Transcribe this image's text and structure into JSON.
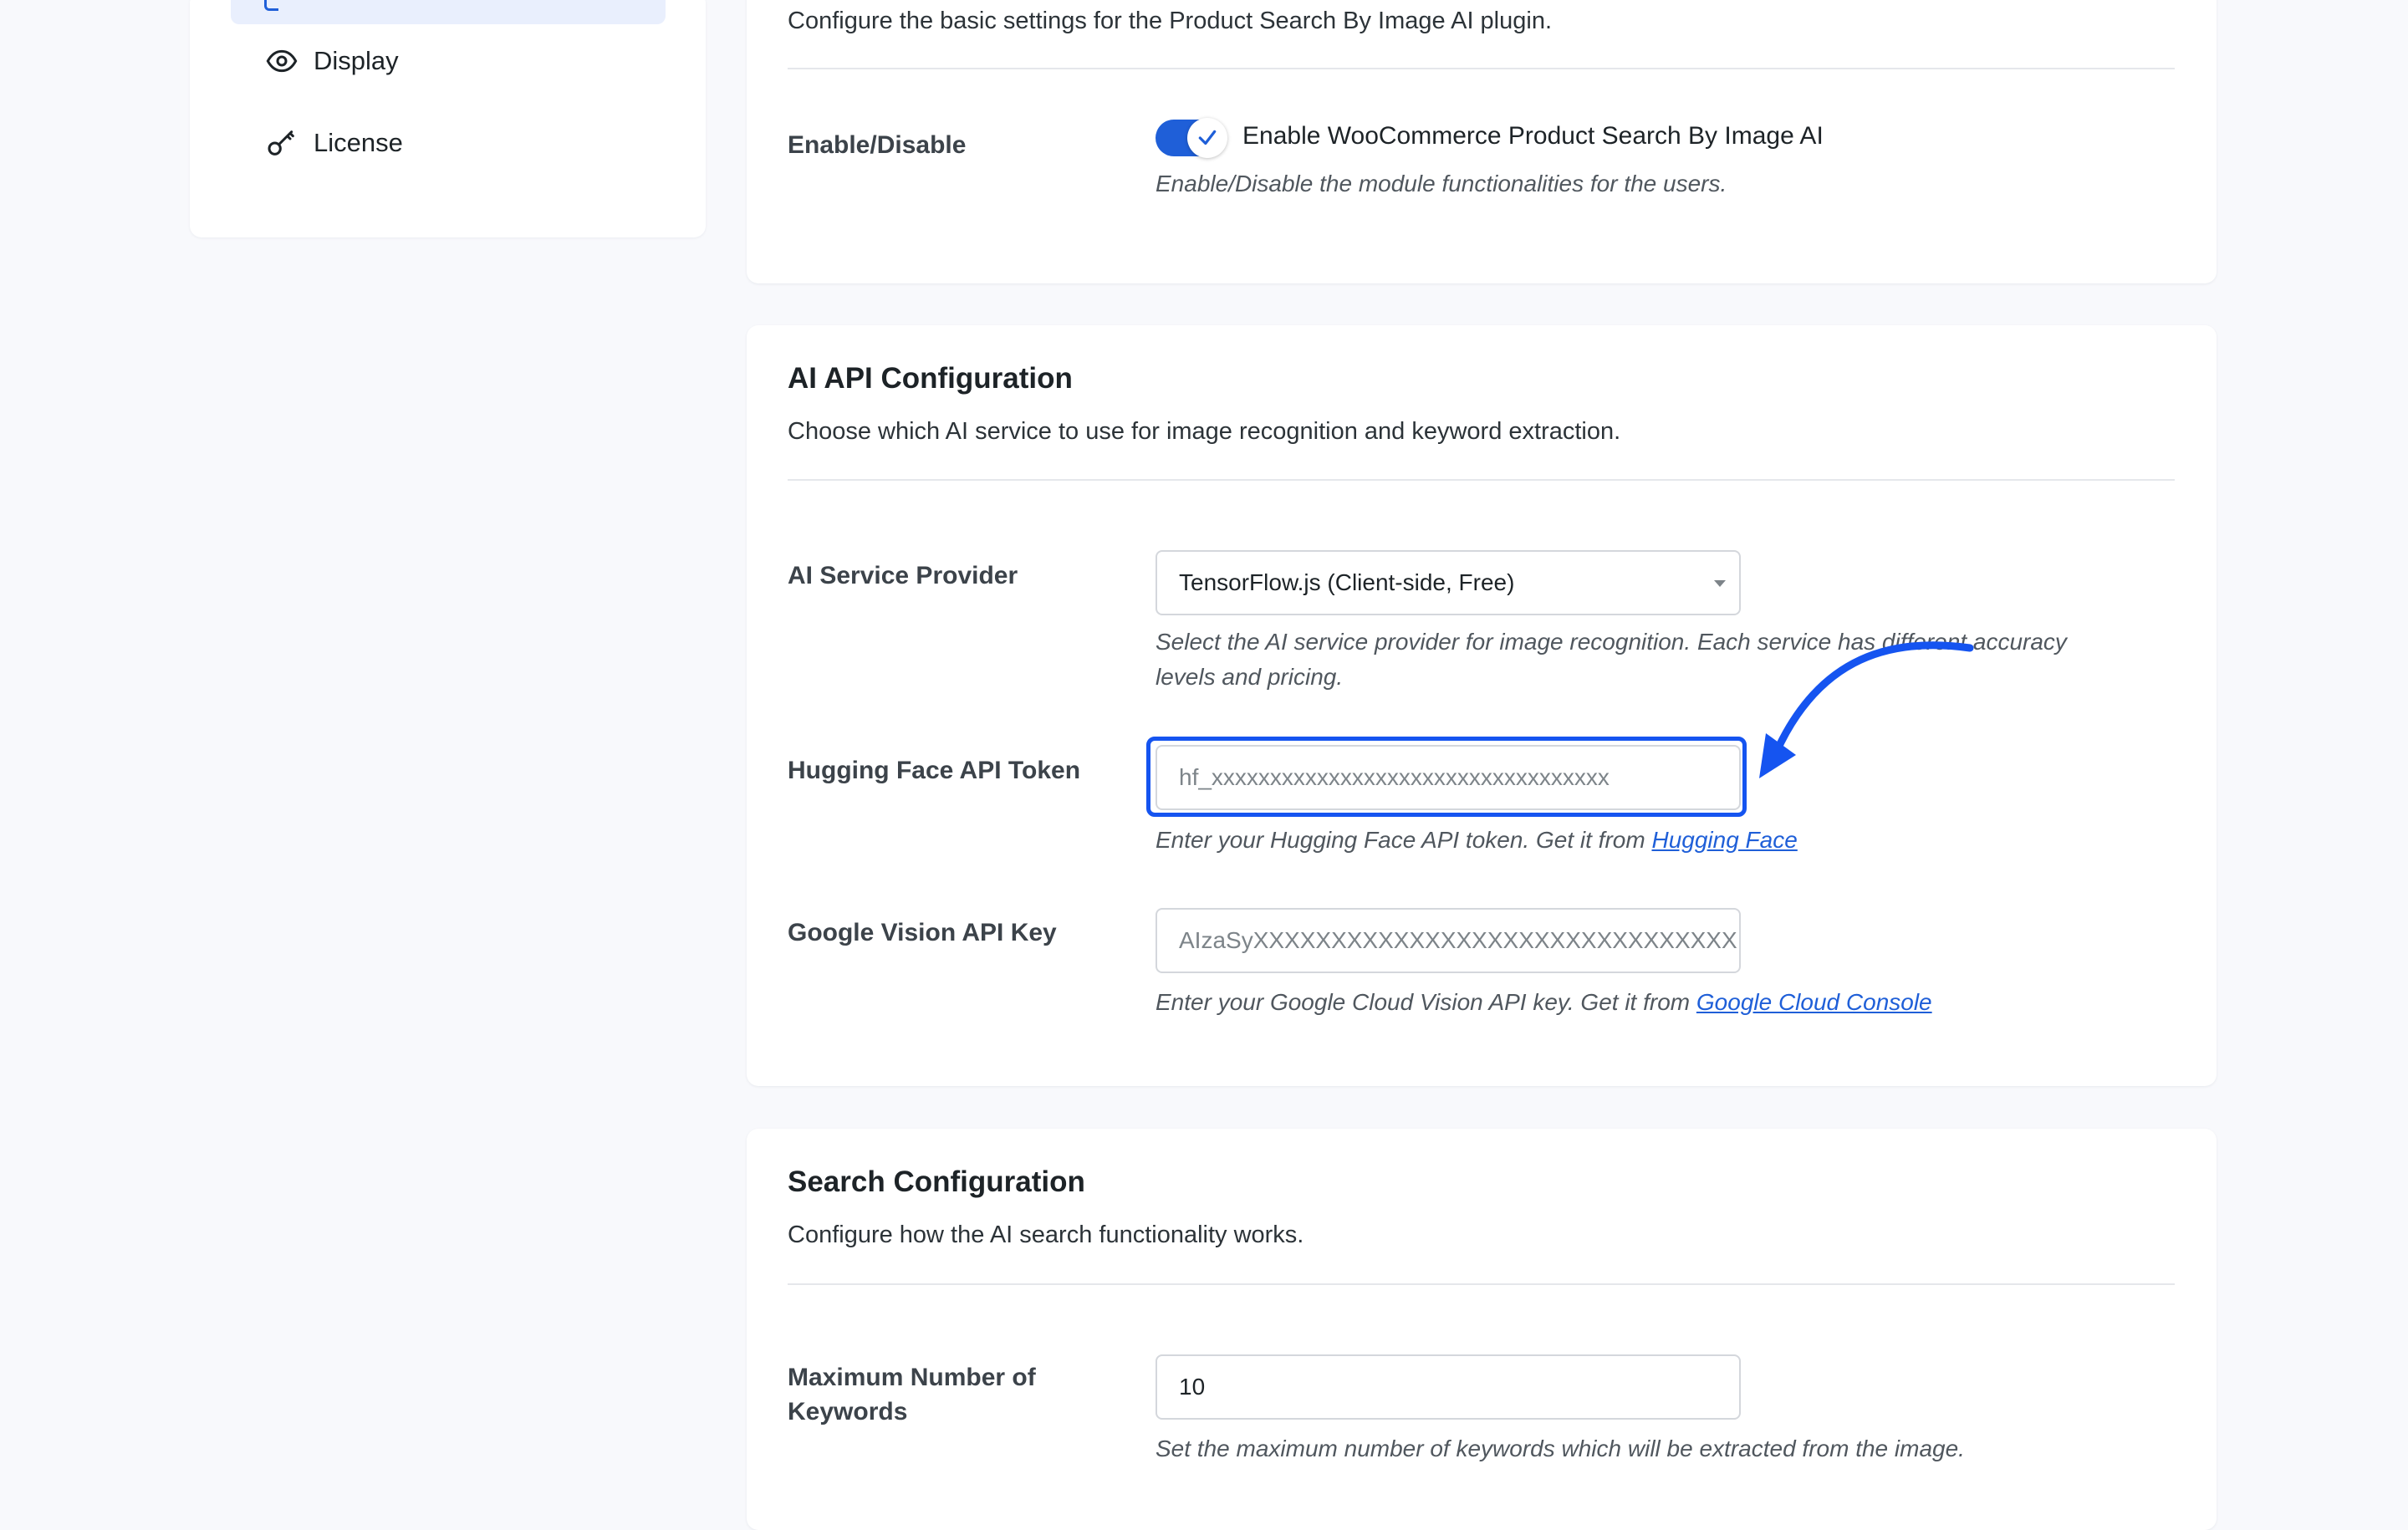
{
  "sidebar": {
    "items": [
      {
        "label": "Display",
        "icon": "eye-icon"
      },
      {
        "label": "License",
        "icon": "key-icon"
      }
    ]
  },
  "general": {
    "description": "Configure the basic settings for the Product Search By Image AI plugin.",
    "enable_label": "Enable/Disable",
    "toggle_label": "Enable WooCommerce Product Search By Image AI",
    "toggle_checked": true,
    "enable_help": "Enable/Disable the module functionalities for the users."
  },
  "ai_api": {
    "title": "AI API Configuration",
    "description": "Choose which AI service to use for image recognition and keyword extraction.",
    "provider_label": "AI Service Provider",
    "provider_value": "TensorFlow.js (Client-side, Free)",
    "provider_help_line1": "Select the AI service provider for image recognition. Each service has different accuracy",
    "provider_help_line2": "levels and pricing.",
    "hf_label": "Hugging Face API Token",
    "hf_placeholder": "hf_xxxxxxxxxxxxxxxxxxxxxxxxxxxxxxxxxx",
    "hf_help_text": "Enter your Hugging Face API token. Get it from ",
    "hf_help_link": "Hugging Face",
    "gv_label": "Google Vision API Key",
    "gv_placeholder": "AIzaSyXXXXXXXXXXXXXXXXXXXXXXXXXXXXXXX",
    "gv_help_text": "Enter your Google Cloud Vision API key. Get it from ",
    "gv_help_link": "Google Cloud Console"
  },
  "search": {
    "title": "Search Configuration",
    "description": "Configure how the AI search functionality works.",
    "max_keywords_label_line1": "Maximum Number of",
    "max_keywords_label_line2": "Keywords",
    "max_keywords_value": "10",
    "max_keywords_help": "Set the maximum number of keywords which will be extracted from the image."
  },
  "colors": {
    "accent": "#1f5fd8",
    "highlight": "#1554f0",
    "background": "#f8f9fc"
  }
}
